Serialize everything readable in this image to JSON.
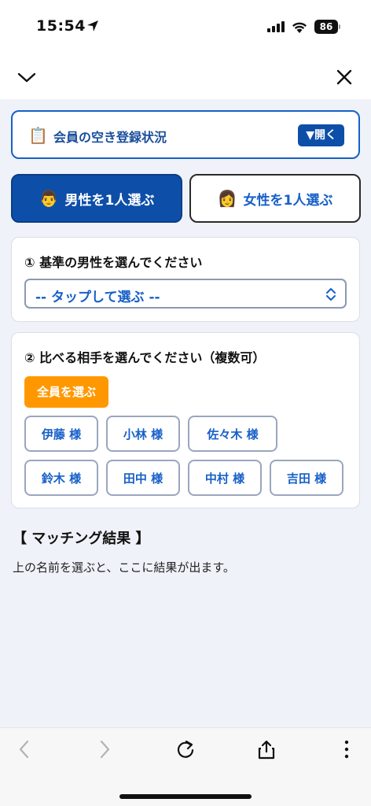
{
  "status_bar": {
    "time": "15:54",
    "battery": "86"
  },
  "registration_card": {
    "icon": "clipboard-icon",
    "title": "会員の空き登録状況",
    "open_label": "▼開く"
  },
  "gender_tabs": [
    {
      "label": "男性を1人選ぶ",
      "icon": "man-face-icon",
      "selected": true
    },
    {
      "label": "女性を1人選ぶ",
      "icon": "woman-face-icon",
      "selected": false
    }
  ],
  "step1": {
    "heading": "① 基準の男性を選んでください",
    "select_value": "-- タップして選ぶ --"
  },
  "step2": {
    "heading": "② 比べる相手を選んでください（複数可）",
    "select_all_label": "全員を選ぶ",
    "names": [
      "伊藤 様",
      "小林 様",
      "佐々木 様",
      "鈴木 様",
      "田中 様",
      "中村 様",
      "吉田 様"
    ]
  },
  "result": {
    "title": "【 マッチング結果 】",
    "text": "上の名前を選ぶと、ここに結果が出ます。"
  },
  "colors": {
    "primary": "#0d4fa8",
    "accent_link": "#1760c8",
    "orange": "#ff9800",
    "background": "#eff2f8"
  }
}
